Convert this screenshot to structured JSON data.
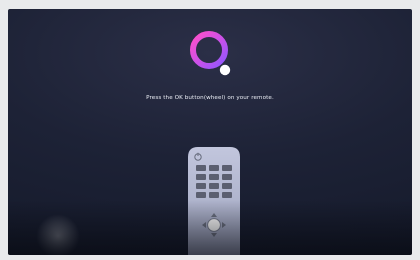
{
  "colors": {
    "background": "#1d2236",
    "prompt_text": "#eceff6",
    "ring_start": "#ff4fc8",
    "ring_end": "#8d57ff",
    "remote_body": "#b9bdd4",
    "remote_keys": "#5b5f70"
  },
  "logo": {
    "icon": "lg-logo-icon"
  },
  "prompt": {
    "text": "Press the OK button(wheel) on your remote."
  },
  "remote": {
    "icon": "remote-control-icon",
    "power_icon": "power-icon",
    "center_button_icon": "ok-wheel-icon",
    "direction_icons": [
      "up-arrow-icon",
      "down-arrow-icon",
      "left-arrow-icon",
      "right-arrow-icon"
    ]
  }
}
